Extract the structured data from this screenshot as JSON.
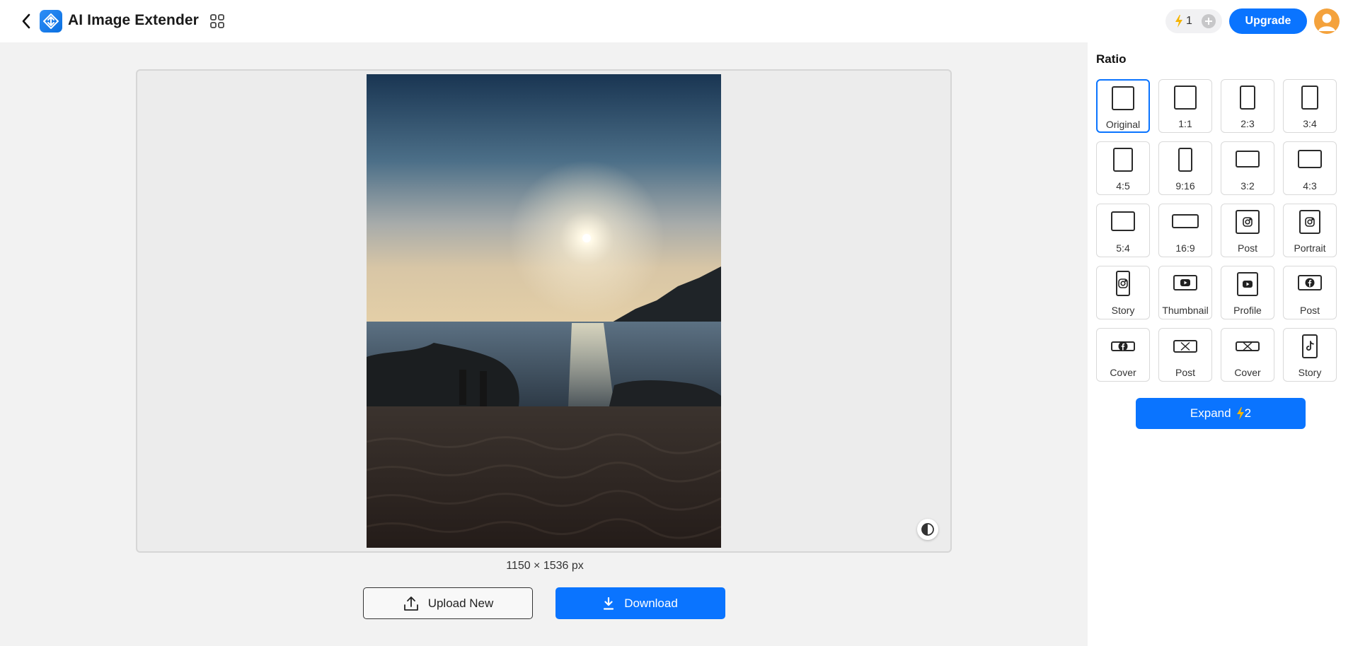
{
  "header": {
    "title": "AI Image Extender",
    "credits": "1",
    "upgrade_label": "Upgrade"
  },
  "canvas": {
    "dimensions": "1150 × 1536 px"
  },
  "actions": {
    "upload_label": "Upload New",
    "download_label": "Download"
  },
  "sidebar": {
    "ratio_title": "Ratio",
    "ratios": [
      {
        "label": "Original",
        "icon": "original-icon",
        "selected": true
      },
      {
        "label": "1:1",
        "icon": "ratio-1-1-icon"
      },
      {
        "label": "2:3",
        "icon": "ratio-2-3-icon"
      },
      {
        "label": "3:4",
        "icon": "ratio-3-4-icon"
      },
      {
        "label": "4:5",
        "icon": "ratio-4-5-icon"
      },
      {
        "label": "9:16",
        "icon": "ratio-9-16-icon"
      },
      {
        "label": "3:2",
        "icon": "ratio-3-2-icon"
      },
      {
        "label": "4:3",
        "icon": "ratio-4-3-icon"
      },
      {
        "label": "5:4",
        "icon": "ratio-5-4-icon"
      },
      {
        "label": "16:9",
        "icon": "ratio-16-9-icon"
      },
      {
        "label": "Post",
        "icon": "instagram-icon"
      },
      {
        "label": "Portrait",
        "icon": "instagram-icon"
      },
      {
        "label": "Story",
        "icon": "instagram-icon"
      },
      {
        "label": "Thumbnail",
        "icon": "youtube-icon"
      },
      {
        "label": "Profile",
        "icon": "youtube-icon"
      },
      {
        "label": "Post",
        "icon": "facebook-icon"
      },
      {
        "label": "Cover",
        "icon": "facebook-icon"
      },
      {
        "label": "Post",
        "icon": "x-icon"
      },
      {
        "label": "Cover",
        "icon": "x-icon"
      },
      {
        "label": "Story",
        "icon": "tiktok-icon"
      }
    ],
    "expand_label": "Expand",
    "expand_cost": "2"
  },
  "colors": {
    "accent": "#0a74ff",
    "selected_border": "#0a74ff",
    "bolt": "#f5b400"
  }
}
